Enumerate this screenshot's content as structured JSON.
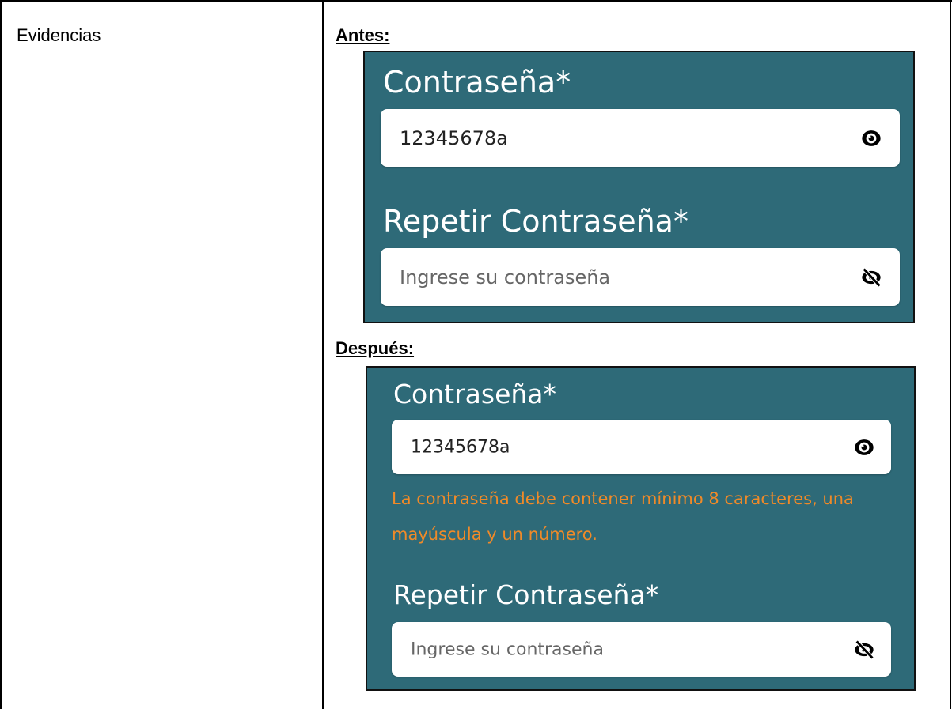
{
  "table": {
    "label": "Evidencias"
  },
  "before": {
    "heading": "Antes:",
    "password_label": "Contraseña*",
    "password_value": "12345678a",
    "password_icon": "eye-icon",
    "repeat_label": "Repetir Contraseña*",
    "repeat_placeholder": "Ingrese su contraseña",
    "repeat_icon": "eye-slash-icon"
  },
  "after": {
    "heading": "Después:",
    "password_label": "Contraseña*",
    "password_value": "12345678a",
    "password_icon": "eye-icon",
    "error_text": "La contraseña debe contener mínimo 8 caracteres, una mayúscula y un número.",
    "repeat_label": "Repetir Contraseña*",
    "repeat_placeholder": "Ingrese su contraseña",
    "repeat_icon": "eye-slash-icon"
  },
  "colors": {
    "panel_bg": "#2e6a78",
    "error": "#f08a28",
    "label_text": "#ffffff"
  }
}
